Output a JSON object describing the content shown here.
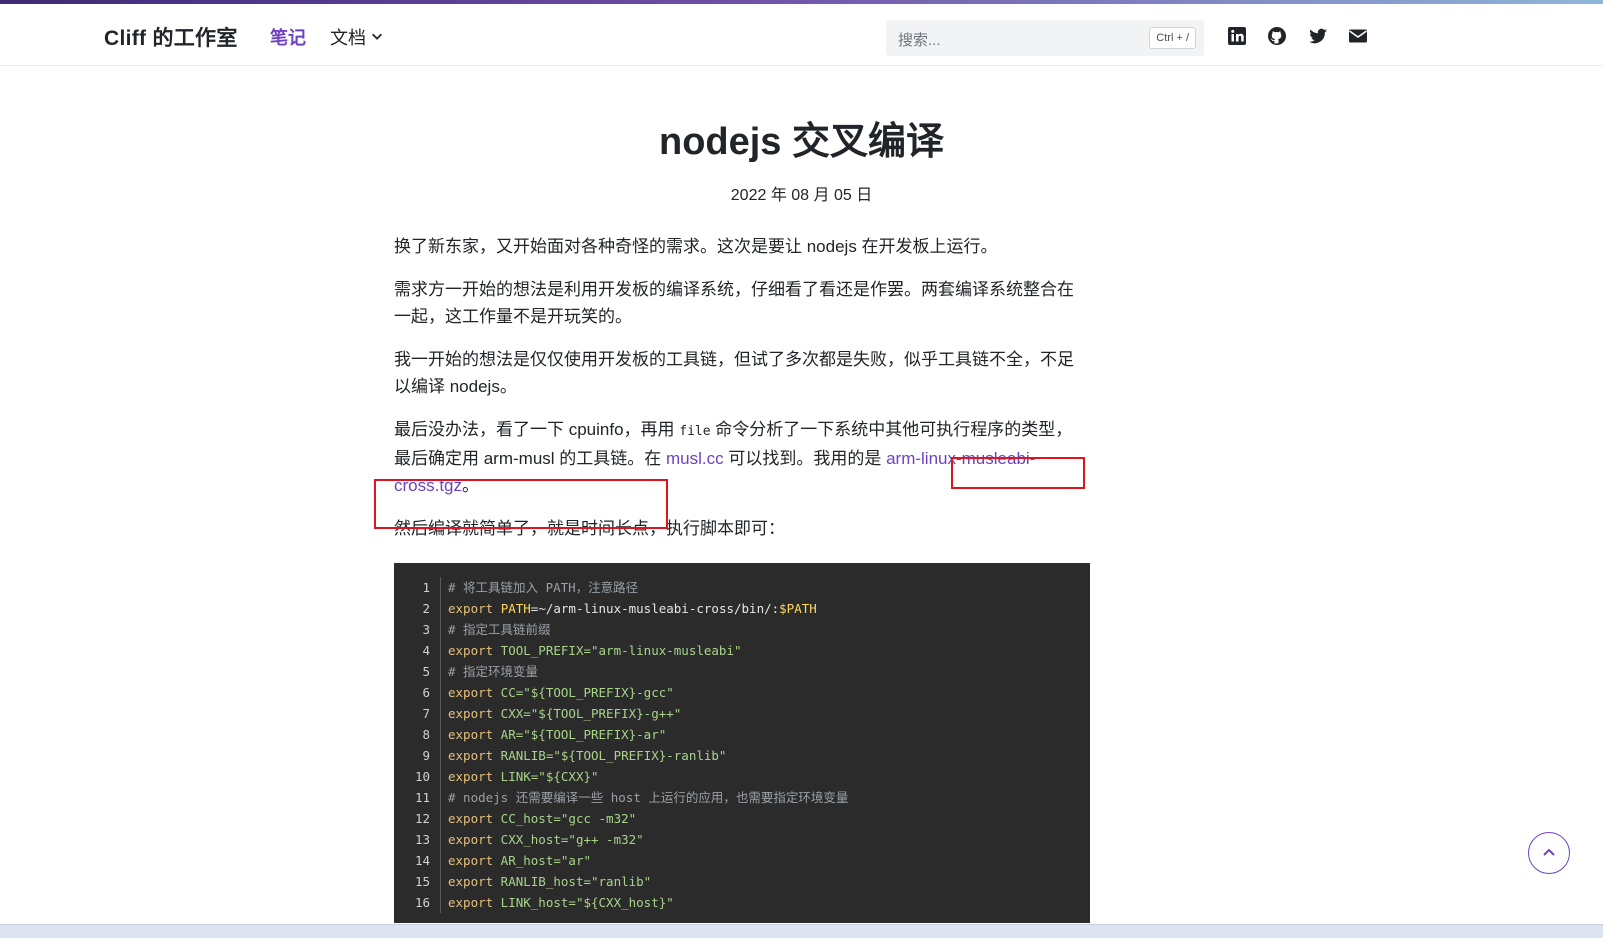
{
  "header": {
    "brand": "Cliff 的工作室",
    "nav": {
      "notes": "笔记",
      "docs": "文档"
    },
    "search": {
      "placeholder": "搜索...",
      "shortcut": "Ctrl + /"
    },
    "social_icons": [
      "linkedin-icon",
      "github-icon",
      "twitter-icon",
      "mail-icon"
    ]
  },
  "article": {
    "title": "nodejs 交叉编译",
    "date": "2022 年 08 月 05 日",
    "p1": "换了新东家，又开始面对各种奇怪的需求。这次是要让 nodejs 在开发板上运行。",
    "p2": "需求方一开始的想法是利用开发板的编译系统，仔细看了看还是作罢。两套编译系统整合在一起，这工作量不是开玩笑的。",
    "p3": "我一开始的想法是仅仅使用开发板的工具链，但试了多次都是失败，似乎工具链不全，不足以编译 nodejs。",
    "p4_a": "最后没办法，看了一下 cpuinfo，再用 ",
    "p4_code": "file",
    "p4_b": " 命令分析了一下系统中其他可执行程序的类型，最后确定用 arm-musl 的工具链。在 ",
    "p4_link1": "musl.cc",
    "p4_c": " 可以找到。我用的是 ",
    "p4_link2": "arm-linux-musleabi-cross.tgz",
    "p4_d": "。",
    "p5": "然后编译就简单了，就是时间长点，执行脚本即可："
  },
  "code": {
    "line_numbers": [
      "1",
      "2",
      "3",
      "4",
      "5",
      "6",
      "7",
      "8",
      "9",
      "10",
      "11",
      "12",
      "13",
      "14",
      "15",
      "16"
    ],
    "lines": [
      {
        "kind": "comment",
        "text": "# 将工具链加入 PATH，注意路径"
      },
      {
        "kind": "path",
        "kw": "export",
        "var": "PATH",
        "rest": "=~/arm-linux-musleabi-cross/bin/:",
        "tail": "$PATH"
      },
      {
        "kind": "comment",
        "text": "# 指定工具链前缀"
      },
      {
        "kind": "assign",
        "kw": "export",
        "rest": " TOOL_PREFIX=\"arm-linux-musleabi\""
      },
      {
        "kind": "comment",
        "text": "# 指定环境变量"
      },
      {
        "kind": "assign",
        "kw": "export",
        "rest": " CC=\"${TOOL_PREFIX}-gcc\""
      },
      {
        "kind": "assign",
        "kw": "export",
        "rest": " CXX=\"${TOOL_PREFIX}-g++\""
      },
      {
        "kind": "assign",
        "kw": "export",
        "rest": " AR=\"${TOOL_PREFIX}-ar\""
      },
      {
        "kind": "assign",
        "kw": "export",
        "rest": " RANLIB=\"${TOOL_PREFIX}-ranlib\""
      },
      {
        "kind": "assign",
        "kw": "export",
        "rest": " LINK=\"${CXX}\""
      },
      {
        "kind": "comment",
        "text": "# nodejs 还需要编译一些 host 上运行的应用，也需要指定环境变量"
      },
      {
        "kind": "assign",
        "kw": "export",
        "rest": " CC_host=\"gcc -m32\""
      },
      {
        "kind": "assign",
        "kw": "export",
        "rest": " CXX_host=\"g++ -m32\""
      },
      {
        "kind": "assign",
        "kw": "export",
        "rest": " AR_host=\"ar\""
      },
      {
        "kind": "assign",
        "kw": "export",
        "rest": " RANLIB_host=\"ranlib\""
      },
      {
        "kind": "assign",
        "kw": "export",
        "rest": " LINK_host=\"${CXX_host}\""
      }
    ]
  },
  "colors": {
    "accent": "#6f42c1",
    "highlight_box": "#e0141e",
    "code_bg": "#2b2b2b"
  }
}
